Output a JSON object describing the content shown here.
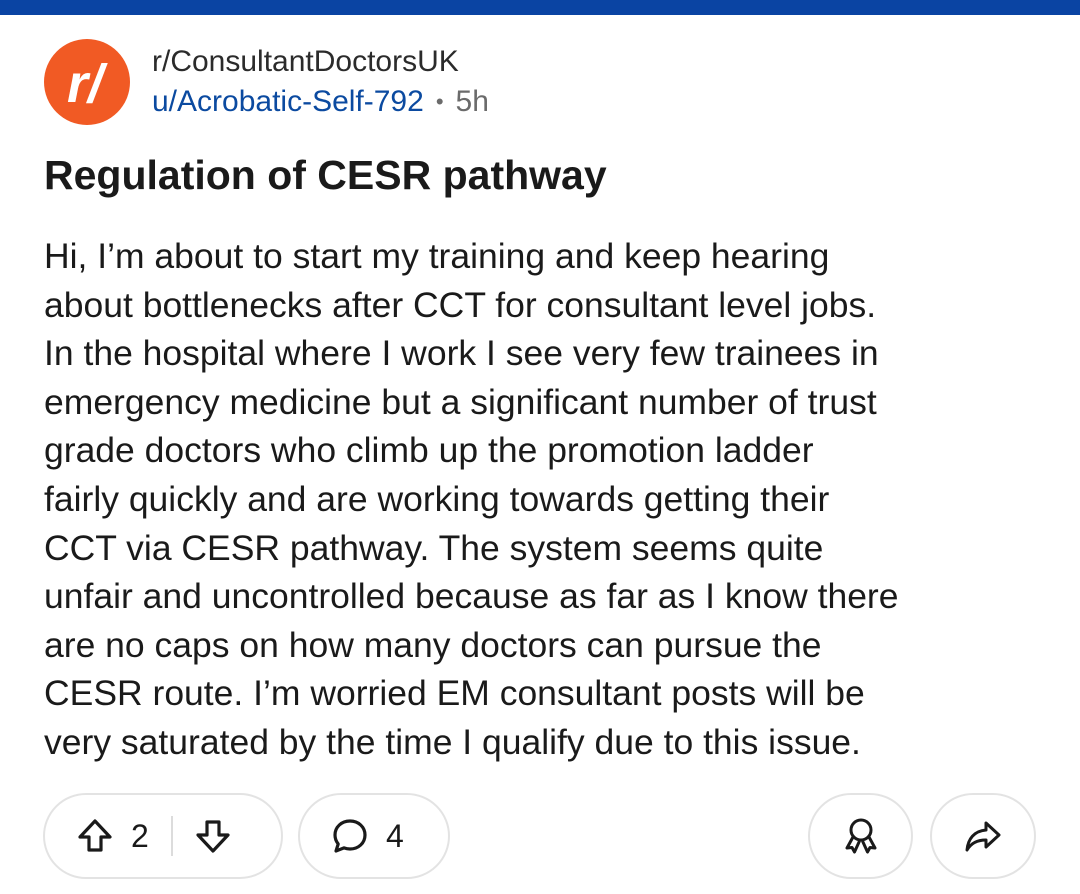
{
  "post": {
    "subreddit": "r/ConsultantDoctorsUK",
    "author": "u/Acrobatic-Self-792",
    "separator": "•",
    "time": "5h",
    "avatar_text": "r/",
    "title": "Regulation of CESR pathway",
    "body_lines": [
      "Hi, I’m about to start my training and keep hearing",
      "about bottlenecks after CCT for consultant level jobs.",
      "In the hospital where I work I see very few trainees in",
      "emergency medicine but a significant number of trust",
      "grade doctors who climb up the promotion ladder",
      "fairly quickly and are working towards getting their",
      "CCT via CESR pathway. The system seems quite",
      "unfair and uncontrolled because as far as I know there",
      "are no caps on how many doctors can pursue the",
      "CESR route. I’m worried EM consultant posts will be",
      "very saturated by the time I qualify due to this issue."
    ]
  },
  "actions": {
    "upvote_count": "2",
    "comment_count": "4",
    "upvote_icon": "upvote-arrow-icon",
    "downvote_icon": "downvote-arrow-icon",
    "comment_icon": "speech-bubble-icon",
    "award_icon": "award-ribbon-icon",
    "share_icon": "share-arrow-icon"
  },
  "colors": {
    "top_bar": "#0a44a3",
    "avatar": "#f15a24",
    "author_link": "#0b4aa0",
    "muted": "#6b6b6b"
  }
}
